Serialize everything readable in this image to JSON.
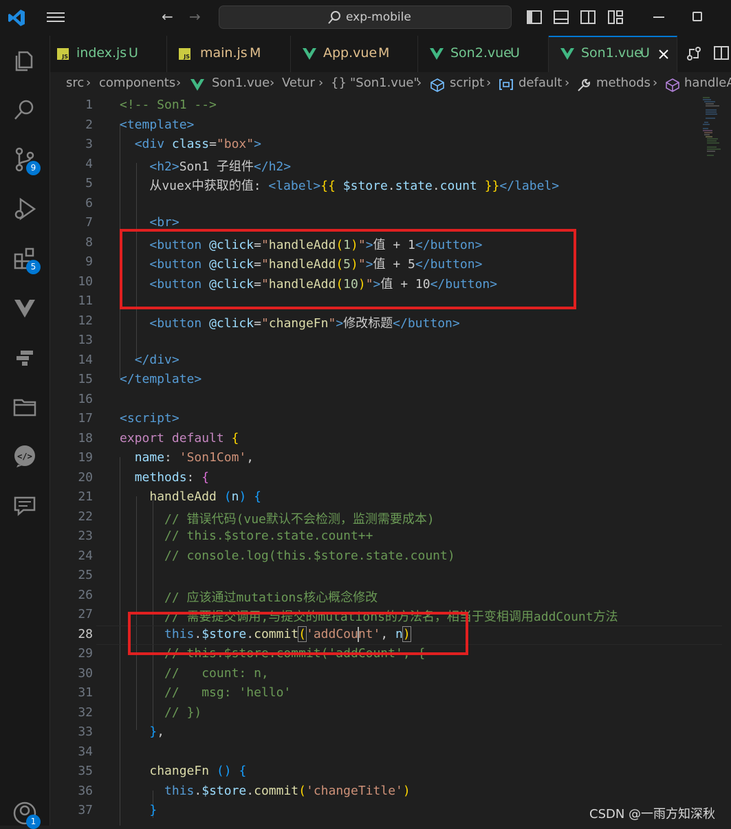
{
  "window": {
    "search_text": "exp-mobile"
  },
  "activity_bar": {
    "items": [
      {
        "icon": "files-icon"
      },
      {
        "icon": "search-icon"
      },
      {
        "icon": "source-control-icon",
        "badge": "9"
      },
      {
        "icon": "run-debug-icon"
      },
      {
        "icon": "extensions-icon",
        "badge": "5"
      },
      {
        "icon": "vue-devtools-icon"
      },
      {
        "icon": "remote-explorer-icon"
      },
      {
        "icon": "folder-icon"
      },
      {
        "icon": "live-server-icon"
      },
      {
        "icon": "chat-icon"
      },
      {
        "icon": "account-icon",
        "badge": "1"
      }
    ]
  },
  "tabs": [
    {
      "name": "index.js",
      "status": "U",
      "icon": "js-icon"
    },
    {
      "name": "main.js",
      "status": "M",
      "icon": "js-icon"
    },
    {
      "name": "App.vue",
      "status": "M",
      "icon": "vue-icon"
    },
    {
      "name": "Son2.vue",
      "status": "U",
      "icon": "vue-icon"
    },
    {
      "name": "Son1.vue",
      "status": "U",
      "icon": "vue-icon",
      "active": true
    }
  ],
  "breadcrumb": {
    "src": "src",
    "components": "components",
    "file": "Son1.vue",
    "vetur": "Vetur",
    "braces": "{}",
    "component": "\"Son1.vue\"",
    "script": "script",
    "default": "default",
    "methods": "methods",
    "handler": "handleAdd"
  },
  "editor": {
    "current_line": 28,
    "line_numbers": [
      "1",
      "2",
      "3",
      "4",
      "5",
      "6",
      "7",
      "8",
      "9",
      "10",
      "11",
      "12",
      "13",
      "14",
      "15",
      "16",
      "17",
      "18",
      "19",
      "20",
      "21",
      "22",
      "23",
      "24",
      "25",
      "26",
      "27",
      "28",
      "29",
      "30",
      "31",
      "32",
      "33",
      "34",
      "35",
      "36",
      "37"
    ]
  },
  "colors": {
    "accent": "#0078d4",
    "annotation_box": "#e02020",
    "editor_background": "#1f1f1f"
  },
  "watermark": "CSDN @一雨方知深秋"
}
